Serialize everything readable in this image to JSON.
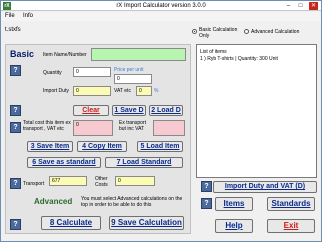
{
  "window": {
    "title": "rX Import Calculator version 3.0.0",
    "icon": "rX",
    "minimize_glyph": "–",
    "maximize_glyph": "□",
    "close_glyph": "✕"
  },
  "menu": {
    "file": "File",
    "info": "Info"
  },
  "filename": "t.stxfs",
  "mode": {
    "basic_label": "Basic Calculation Only",
    "advanced_label": "Advanced Calculation",
    "selected": "basic"
  },
  "basic": {
    "heading": "Basic",
    "item_name_label": "Item Name/Number",
    "item_name_value": "",
    "quantity_label": "Quantity",
    "quantity_value": "0",
    "price_per_unit_label": "Price per unit",
    "price_per_unit_value": "0",
    "import_duty_label": "Import Duty",
    "import_duty_value": "0",
    "vat_label": "VAT etc",
    "vat_value": "0",
    "percent_sign": "%"
  },
  "buttons": {
    "help_glyph": "?",
    "clear": "Clear",
    "save_d": "1 Save D",
    "load_d": "2 Load D",
    "save_item": "3 Save Item",
    "copy_item": "4 Copy Item",
    "load_item": "5 Load Item",
    "save_standard": "6 Save as standard",
    "load_standard": "7 Load Standard",
    "calculate": "8 Calculate",
    "save_calculation": "9 Save Calculation",
    "import_duty_vat": "Import Duty and VAT (D)",
    "items": "Items",
    "standards": "Standards",
    "help": "Help",
    "exit": "Exit"
  },
  "totals": {
    "total_cost_label": "Total cost this item ex transport , VAT etc",
    "total_cost_value": "0",
    "ex_transport_label": "Ex transport but inc VAT",
    "ex_transport_value": ""
  },
  "transport": {
    "label": "Transport",
    "value": "677",
    "other_costs_label": "Other Costs",
    "other_costs_value": "0"
  },
  "advanced": {
    "heading": "Advanced",
    "note": "You must select Advanced calculations on the top in order to be able to do this"
  },
  "list": {
    "header": "List of items",
    "rows": [
      "1 ) Ryb T-shirts | Quantity: 300 Unit"
    ]
  }
}
